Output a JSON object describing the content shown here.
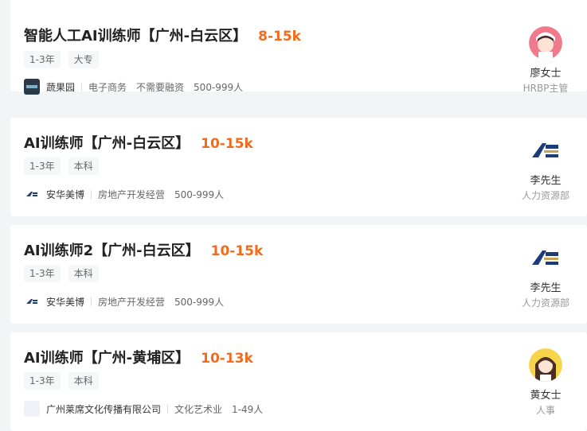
{
  "jobs": [
    {
      "title": "智能人工AI训练师【广州-白云区】",
      "salary": "8-15k",
      "tags": [
        "1-3年",
        "大专"
      ],
      "company": "蔬果园",
      "company_meta": [
        "电子商务",
        "不需要融资",
        "500-999人"
      ],
      "recruiter_name": "廖女士",
      "recruiter_role": "HRBP主管"
    },
    {
      "title": "AI训练师【广州-白云区】",
      "salary": "10-15k",
      "tags": [
        "1-3年",
        "本科"
      ],
      "company": "安华美博",
      "company_meta": [
        "房地产开发经营",
        "500-999人"
      ],
      "recruiter_name": "李先生",
      "recruiter_role": "人力资源部"
    },
    {
      "title": "AI训练师2【广州-白云区】",
      "salary": "10-15k",
      "tags": [
        "1-3年",
        "本科"
      ],
      "company": "安华美博",
      "company_meta": [
        "房地产开发经营",
        "500-999人"
      ],
      "recruiter_name": "李先生",
      "recruiter_role": "人力资源部"
    },
    {
      "title": "AI训练师【广州-黄埔区】",
      "salary": "10-13k",
      "tags": [
        "1-3年",
        "本科"
      ],
      "company": "广州莱席文化传播有限公司",
      "company_meta": [
        "文化艺术业",
        "1-49人"
      ],
      "recruiter_name": "黄女士",
      "recruiter_role": "人事"
    }
  ]
}
